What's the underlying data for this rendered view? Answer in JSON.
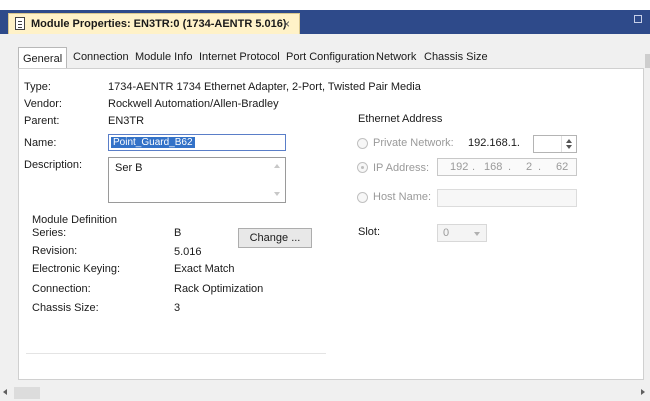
{
  "window": {
    "title": "Module Properties: EN3TR:0 (1734-AENTR 5.016)",
    "close_glyph": "×"
  },
  "tabs": [
    {
      "label": "General",
      "active": true
    },
    {
      "label": "Connection"
    },
    {
      "label": "Module Info"
    },
    {
      "label": "Internet Protocol"
    },
    {
      "label": "Port Configuration"
    },
    {
      "label": "Network"
    },
    {
      "label": "Chassis Size"
    }
  ],
  "general": {
    "type_label": "Type:",
    "type_value": "1734-AENTR 1734 Ethernet Adapter, 2-Port, Twisted Pair Media",
    "vendor_label": "Vendor:",
    "vendor_value": "Rockwell Automation/Allen-Bradley",
    "parent_label": "Parent:",
    "parent_value": "EN3TR",
    "name_label": "Name:",
    "name_value": "Point_Guard_B62",
    "description_label": "Description:",
    "description_value": "Ser B"
  },
  "module_definition": {
    "heading": "Module Definition",
    "series_label": "Series:",
    "series_value": "B",
    "revision_label": "Revision:",
    "revision_value": "5.016",
    "keying_label": "Electronic Keying:",
    "keying_value": "Exact Match",
    "connection_label": "Connection:",
    "connection_value": "Rack Optimization",
    "chassis_label": "Chassis Size:",
    "chassis_value": "3",
    "change_button": "Change ..."
  },
  "ethernet": {
    "heading": "Ethernet Address",
    "private_label": "Private Network:",
    "private_prefix": "192.168.1.",
    "ip_label": "IP Address:",
    "ip_octets": [
      "192",
      "168",
      "2",
      "62"
    ],
    "ip_dots": ".",
    "host_label": "Host Name:",
    "selected_option": "IP Address"
  },
  "slot": {
    "label": "Slot:",
    "value": "0"
  },
  "colors": {
    "titlebar": "#2e4a8a",
    "doc_tab": "#fff2c8",
    "selection": "#3372c8"
  },
  "icons": {
    "document": "document-icon",
    "close": "close-icon",
    "scroll_left": "scroll-left-arrow-icon",
    "scroll_right": "scroll-right-arrow-icon"
  }
}
